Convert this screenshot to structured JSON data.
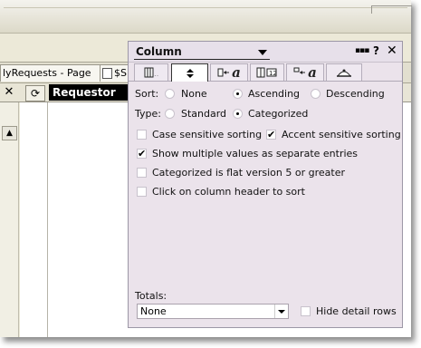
{
  "background": {
    "tabs": [
      {
        "label": "lyRequests - Page",
        "close": "✕"
      },
      {
        "label": "$S"
      }
    ],
    "view": {
      "close_glyph": "✕",
      "refresh_glyph": "⟳",
      "column_header": "Requestor",
      "scroll_up_glyph": "▲"
    }
  },
  "panel": {
    "title": "Column",
    "title_controls": {
      "help": "?",
      "close": "✕"
    },
    "tabs": [
      {
        "name": "basics-tab",
        "icon": "column-basics-icon"
      },
      {
        "name": "sorting-tab",
        "icon": "sort-icon",
        "active": true
      },
      {
        "name": "font-tab",
        "icon": "font-icon",
        "glyph": "a"
      },
      {
        "name": "numbers-tab",
        "icon": "number-format-icon"
      },
      {
        "name": "title-font-tab",
        "icon": "title-font-icon",
        "glyph": "a"
      },
      {
        "name": "advanced-tab",
        "icon": "advanced-hat-icon"
      }
    ],
    "sort": {
      "label": "Sort:",
      "options": [
        "None",
        "Ascending",
        "Descending"
      ],
      "selected": "Ascending"
    },
    "type": {
      "label": "Type:",
      "options": [
        "Standard",
        "Categorized"
      ],
      "selected": "Categorized"
    },
    "checkboxes": {
      "case_sensitive": {
        "label": "Case sensitive sorting",
        "checked": false
      },
      "accent_sensitive": {
        "label": "Accent sensitive sorting",
        "checked": true
      },
      "multiple_values": {
        "label": "Show multiple values as separate entries",
        "checked": true
      },
      "flat_v5": {
        "label": "Categorized is flat version 5 or greater",
        "checked": false
      },
      "click_header": {
        "label": "Click on column header to sort",
        "checked": false
      },
      "hide_detail": {
        "label": "Hide detail rows",
        "checked": false
      }
    },
    "totals": {
      "label": "Totals:",
      "value": "None"
    }
  },
  "check_glyph": "✔"
}
